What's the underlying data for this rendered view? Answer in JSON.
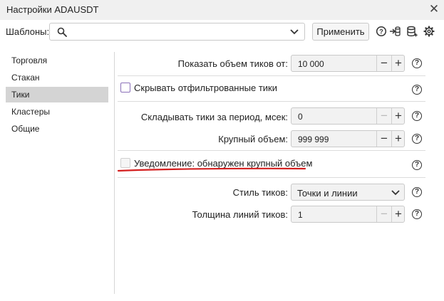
{
  "window": {
    "title": "Настройки ADAUSDT"
  },
  "templates": {
    "label": "Шаблоны:",
    "value": "",
    "apply_label": "Применить"
  },
  "toolbar_icons": [
    "help-icon",
    "import-icon",
    "database-icon",
    "gear-icon"
  ],
  "sidebar": {
    "items": [
      {
        "label": "Торговля",
        "active": false
      },
      {
        "label": "Стакан",
        "active": false
      },
      {
        "label": "Тики",
        "active": true
      },
      {
        "label": "Кластеры",
        "active": false
      },
      {
        "label": "Общие",
        "active": false
      }
    ]
  },
  "settings": {
    "show_tick_volume": {
      "label": "Показать объем тиков от:",
      "value": "10 000"
    },
    "hide_filtered": {
      "label": "Скрывать отфильтрованные тики",
      "checked": false
    },
    "merge_period": {
      "label": "Складывать тики за период, мсек:",
      "value": "0"
    },
    "large_volume": {
      "label": "Крупный объем:",
      "value": "999 999"
    },
    "large_volume_alert": {
      "label": "Уведомление: обнаружен крупный объем",
      "checked": false,
      "enabled": false
    },
    "tick_style": {
      "label": "Стиль тиков:",
      "value": "Точки и линии"
    },
    "line_thickness": {
      "label": "Толщина линий тиков:",
      "value": "1"
    }
  },
  "annotation": {
    "underline_color": "#d42020"
  }
}
